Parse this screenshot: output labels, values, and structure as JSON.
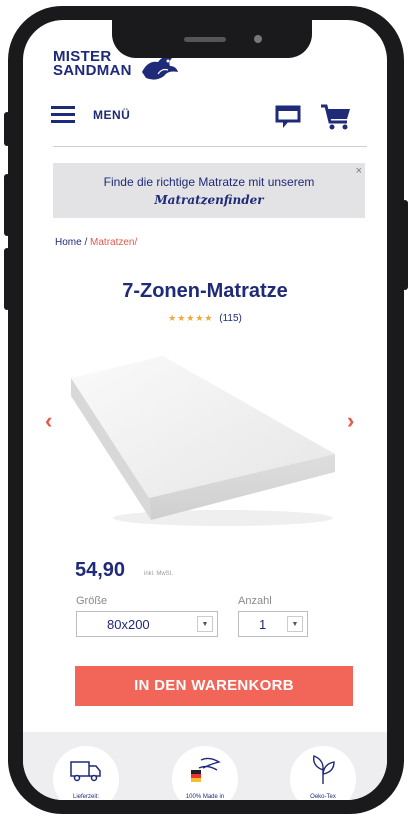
{
  "logo": {
    "line1": "MISTER",
    "line2": "SANDMAN"
  },
  "header": {
    "menu_label": "MENÜ"
  },
  "finder_banner": {
    "text": "Finde die richtige Matratze mit unserem",
    "link": "Matratzenfinder",
    "close": "×"
  },
  "breadcrumb": {
    "home": "Home",
    "separator": "/",
    "current": "Matratzen/"
  },
  "product": {
    "title": "7-Zonen-Matratze",
    "stars": "★★★★★",
    "rating_count": "(115)",
    "price": "54,90",
    "price_note": "inkl. MwSt.",
    "size_label": "Größe",
    "size_value": "80x200",
    "qty_label": "Anzahl",
    "qty_value": "1",
    "add_to_cart": "IN DEN WARENKORB",
    "prev_arrow": "‹",
    "next_arrow": "›"
  },
  "features": [
    {
      "label": "Lieferzeit:",
      "icon": "truck-icon"
    },
    {
      "label": "100% Made in",
      "icon": "germany-tag-icon"
    },
    {
      "label": "Oeko-Tex",
      "icon": "leaf-icon"
    }
  ],
  "colors": {
    "brand": "#1f2a78",
    "accent": "#f2665a",
    "stars": "#f3a73a"
  }
}
